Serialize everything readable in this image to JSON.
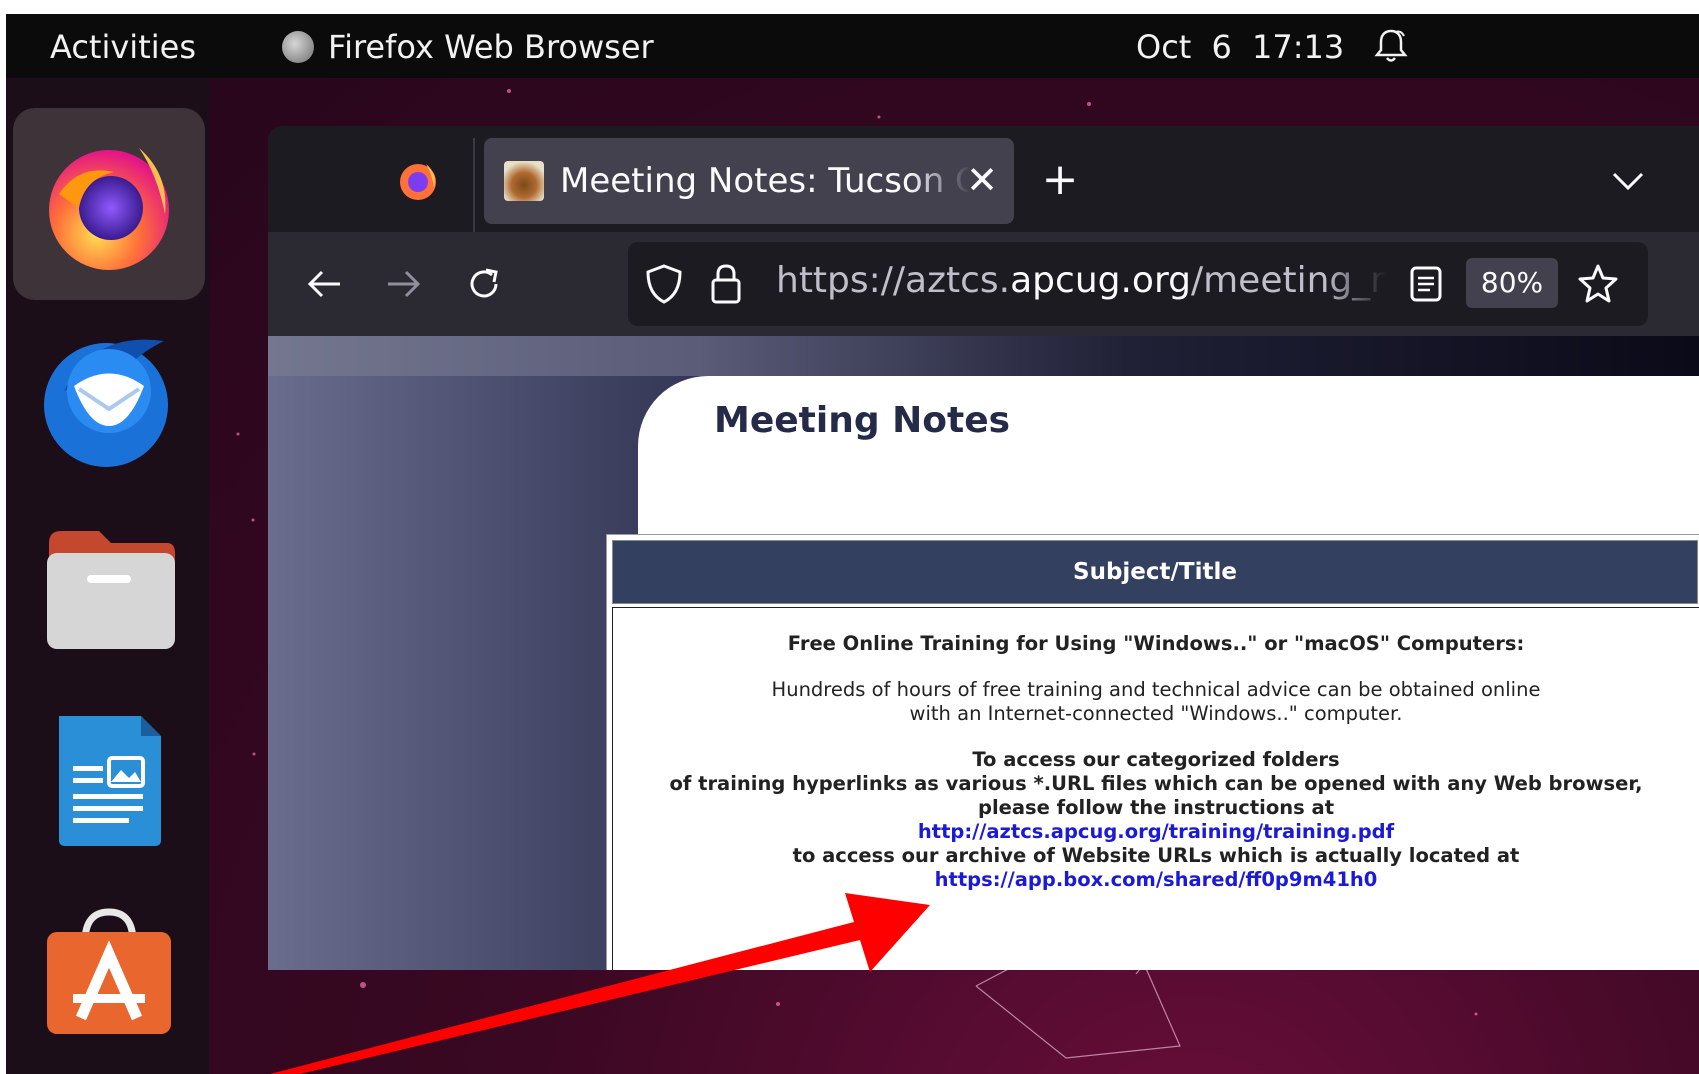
{
  "topbar": {
    "activities": "Activities",
    "app_name": "Firefox Web Browser",
    "date": "Oct 6",
    "time": "17:13"
  },
  "dock": {
    "items": [
      {
        "name": "Firefox",
        "icon": "firefox-icon",
        "active": true
      },
      {
        "name": "Thunderbird",
        "icon": "thunderbird-icon"
      },
      {
        "name": "Files",
        "icon": "files-icon"
      },
      {
        "name": "LibreOffice Writer",
        "icon": "writer-icon"
      },
      {
        "name": "Ubuntu Software",
        "icon": "software-store-icon"
      }
    ]
  },
  "browser": {
    "tab_title": "Meeting Notes: Tucson Computer Society",
    "url_prefix": "https://aztcs.",
    "url_domain": "apcug.org",
    "url_suffix": "/meeting_notes",
    "zoom": "80%"
  },
  "page": {
    "title": "Meeting Notes",
    "table_header": "Subject/Title",
    "heading": "Free Online Training for Using \"Windows..\" or \"macOS\" Computers:",
    "para1_line1": "Hundreds of hours of free training and technical advice can be obtained online",
    "para1_line2": "with an Internet-connected \"Windows..\" computer.",
    "para2_line1": "To access our categorized folders",
    "para2_line2": "of training hyperlinks as various *.URL files which can be opened with any Web browser,",
    "para2_line3": "please follow the instructions at",
    "link1": "http://aztcs.apcug.org/training/training.pdf",
    "para2_line4": "to access our archive of Website URLs which is actually located at",
    "link2": "https://app.box.com/shared/ff0p9m41h0"
  },
  "colors": {
    "accent": "#e95420",
    "table_header_bg": "#34405f",
    "link": "#1a1ad8",
    "arrow": "#ff0000"
  }
}
